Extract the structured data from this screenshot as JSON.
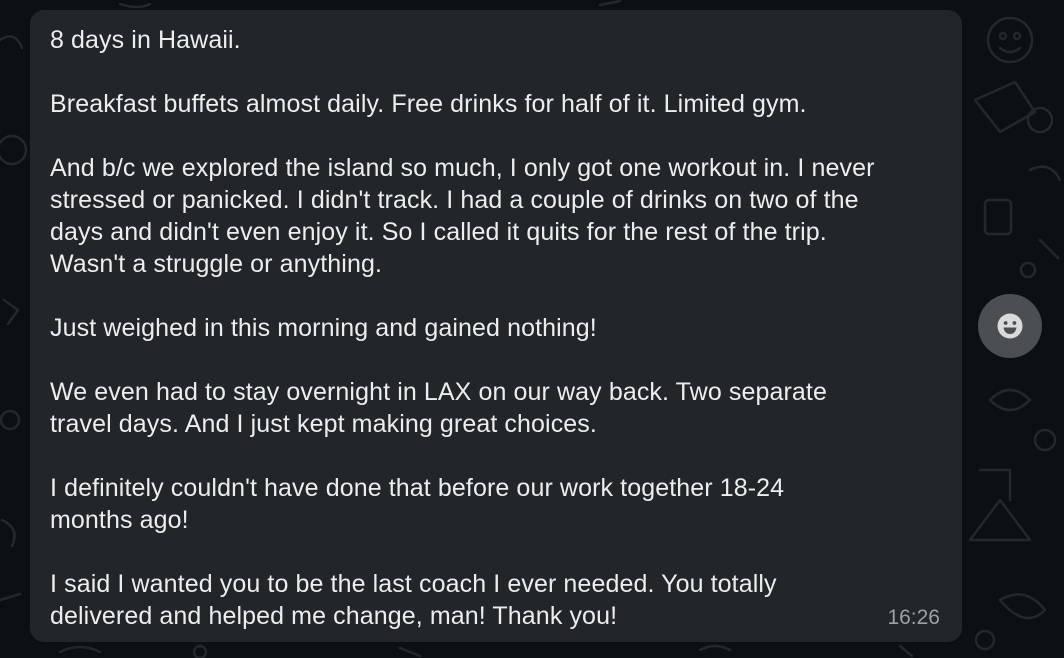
{
  "message": {
    "text": "8 days in Hawaii.\n\nBreakfast buffets almost daily. Free drinks for half of it. Limited gym.\n\nAnd b/c we explored the island so much, I only got one workout in. I never\nstressed or panicked. I didn't track. I had a couple of drinks on two of the\ndays and didn't even enjoy it. So I called it quits for the rest of the trip.\nWasn't a struggle or anything.\n\nJust weighed in this morning and gained nothing!\n\nWe even had to stay overnight in LAX on our way back. Two separate\ntravel days. And I just kept making great choices.\n\nI definitely couldn't have done that before our work together 18-24\nmonths ago!\n\nI said I wanted you to be the last coach I ever needed. You totally\ndelivered and helped me change, man! Thank you!",
    "timestamp": "16:26"
  },
  "react_button": {
    "icon": "smiley-face-icon"
  },
  "colors": {
    "background": "#0c1013",
    "bubble": "#222629",
    "text": "#ecedee",
    "timestamp": "#9aa0a4",
    "react_button_bg": "#4b4f52"
  }
}
